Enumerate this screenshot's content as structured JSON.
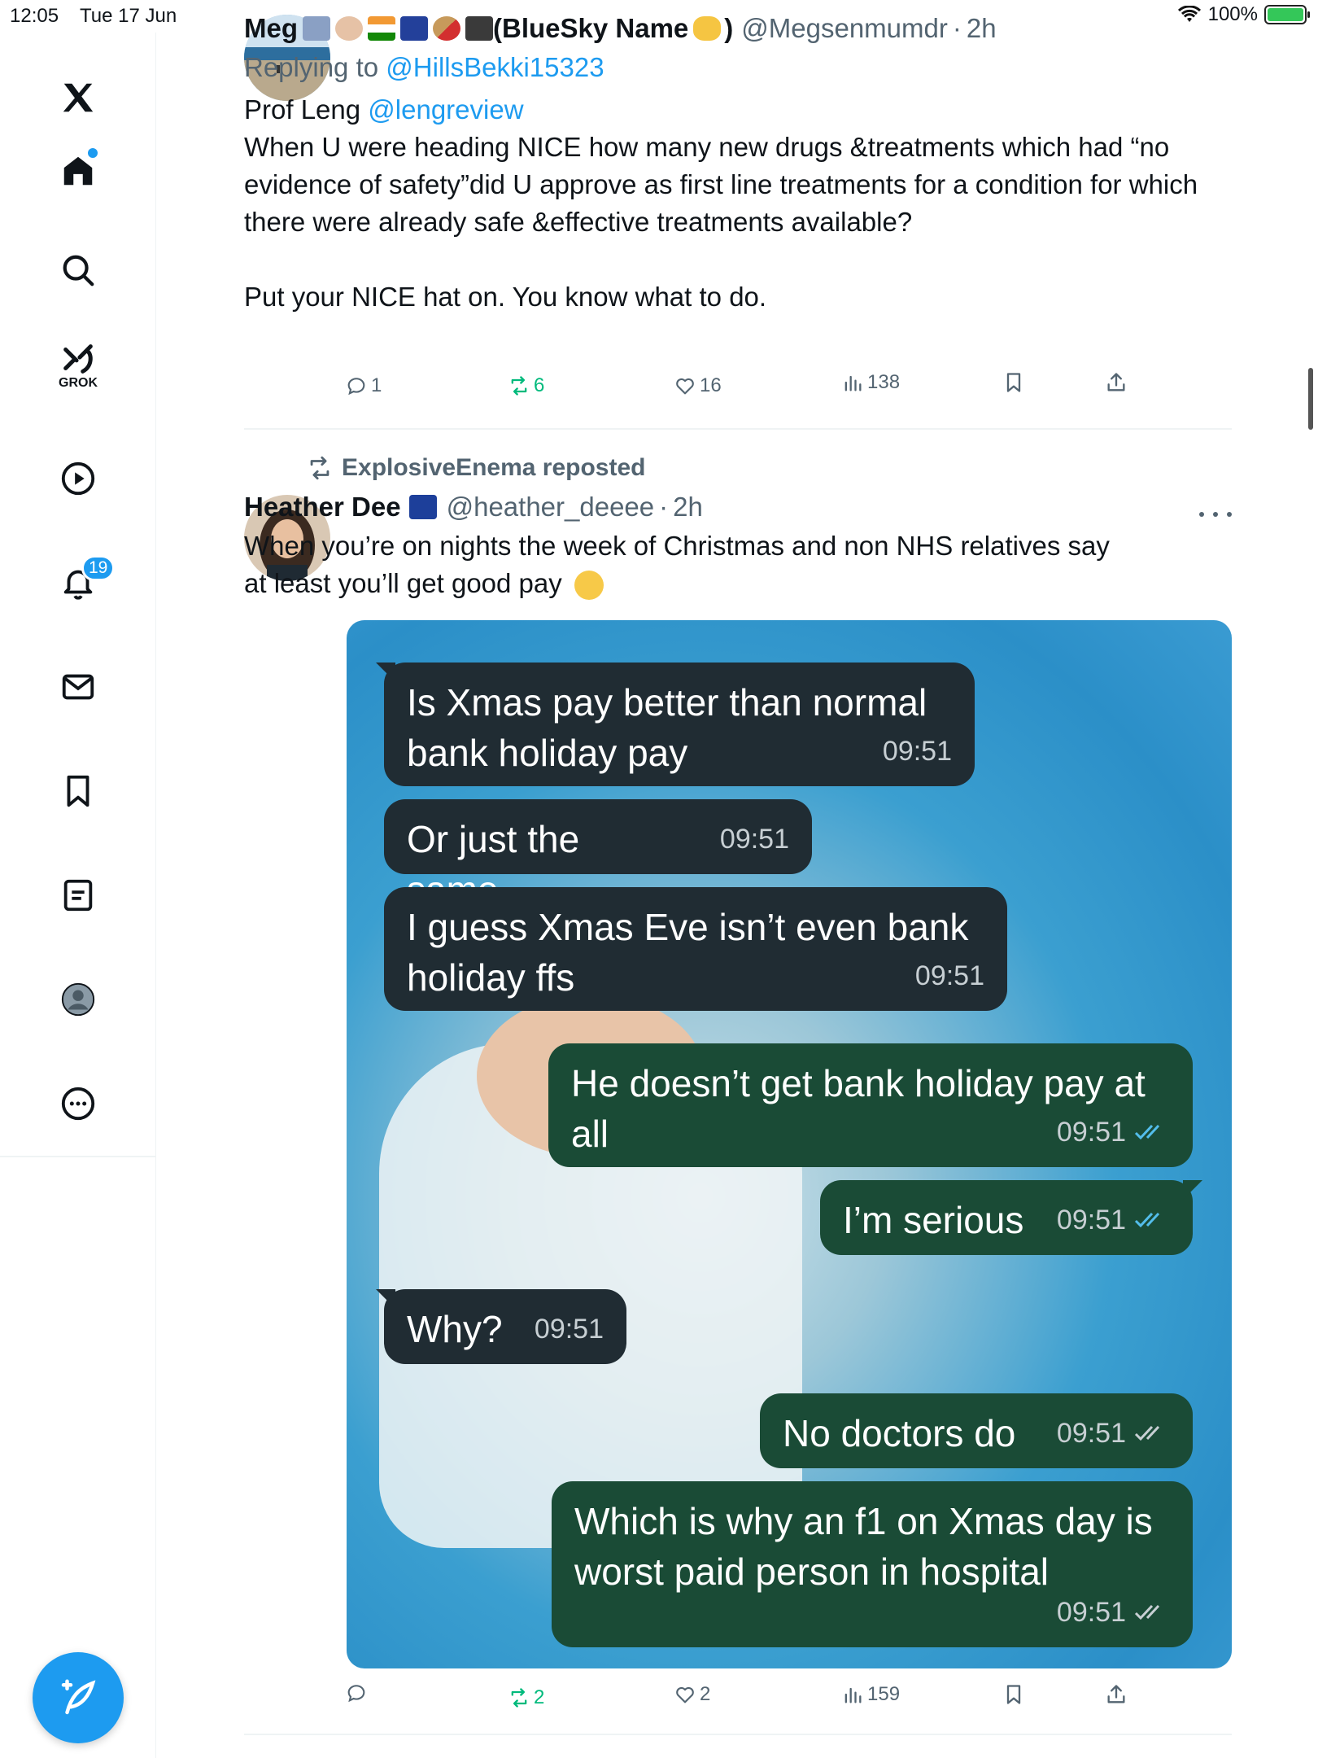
{
  "status_bar": {
    "time": "12:05",
    "date": "Tue 17 Jun",
    "battery": "100%"
  },
  "nav": {
    "grok_label": "GROK",
    "notifications_count": "19",
    "items": [
      "home",
      "search",
      "grok",
      "videos",
      "notifications",
      "messages",
      "bookmarks",
      "lists",
      "profile",
      "more"
    ]
  },
  "tweet1": {
    "display_name": "Meg",
    "name_suffix": "(BlueSky Name",
    "name_suffix_close": ")",
    "handle": "@Megsenmumdr",
    "time": "2h",
    "replying_label": "Replying to",
    "replying_handle": "@HillsBekki15323",
    "text_prefix": "Prof Leng ",
    "mention": "@lengreview",
    "text_body": "When U were heading NICE how many new drugs &treatments which had “no evidence of safety”did U approve as first line treatments for a condition for which there were already safe &effective treatments available?\n\nPut your NICE hat on. You know what to do.",
    "replies": "1",
    "reposts": "6",
    "likes": "16",
    "views": "138"
  },
  "tweet2": {
    "repost_label": "ExplosiveEnema reposted",
    "display_name": "Heather Dee",
    "handle": "@heather_deeee",
    "time": "2h",
    "text": "When you’re on nights the week of Christmas and non NHS relatives say at least you’ll get good pay",
    "replies": "",
    "reposts": "2",
    "likes": "2",
    "views": "159",
    "messages": [
      {
        "dir": "in",
        "text": "Is Xmas pay better than normal bank holiday pay",
        "time": "09:51"
      },
      {
        "dir": "in",
        "text": "Or just the same",
        "time": "09:51"
      },
      {
        "dir": "in",
        "text": "I guess Xmas Eve isn’t even bank holiday ffs",
        "time": "09:51"
      },
      {
        "dir": "out",
        "text": "He doesn’t get bank holiday pay at all",
        "time": "09:51"
      },
      {
        "dir": "out",
        "text": "I’m serious",
        "time": "09:51"
      },
      {
        "dir": "in",
        "text": "Why?",
        "time": "09:51"
      },
      {
        "dir": "out",
        "text": "No doctors do",
        "time": "09:51"
      },
      {
        "dir": "out",
        "text": "Which is why an f1 on Xmas day is worst paid person in hospital",
        "time": "09:51"
      }
    ]
  },
  "colors": {
    "accent": "#1d9bf0",
    "repost_green": "#00ba7c",
    "muted": "#536471"
  }
}
